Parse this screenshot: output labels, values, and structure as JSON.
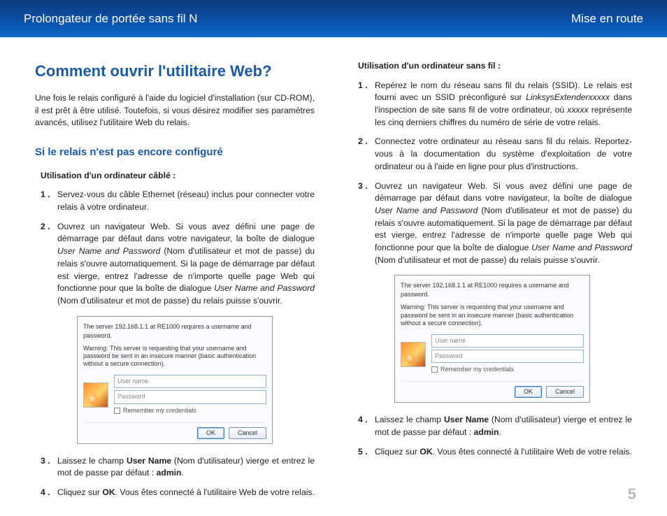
{
  "header": {
    "left": "Prolongateur de portée sans fil N",
    "right": "Mise en route"
  },
  "page_number": "5",
  "left": {
    "h1": "Comment ouvrir l'utilitaire Web?",
    "lead": "Une fois le relais configuré à l'aide du logiciel d'installation (sur CD-ROM), il est prêt à être utilisé. Toutefois, si vous désirez modifier ses paramètres avancés, utilisez l'utilitaire Web du relais.",
    "h2": "Si le relais n'est pas encore configuré",
    "subhead": "Utilisation d'un ordinateur câblé :",
    "steps": {
      "n1": "1 .",
      "s1": "Servez-vous du câble Ethernet (réseau) inclus pour connecter votre relais à votre ordinateur.",
      "n2": "2 .",
      "s2a": "Ouvrez un navigateur Web. Si vous avez défini une page de démarrage par défaut dans votre navigateur, la boîte de dialogue ",
      "s2b": "User Name and Password",
      "s2c": " (Nom d'utilisateur et mot de passe) du relais s'ouvre automatiquement. Si la page de démarrage par défaut est vierge, entrez l'adresse de n'importe quelle page Web qui fonctionne pour que la boîte de dialogue ",
      "s2d": "User Name and Password",
      "s2e": " (Nom d'utilisateur et mot de passe) du relais puisse s'ouvrir.",
      "n3": "3 .",
      "s3a": "Laissez le champ ",
      "s3b": "User Name",
      "s3c": " (Nom d'utilisateur) vierge et entrez le mot de passe par défaut : ",
      "s3d": "admin",
      "s3e": ".",
      "n4": "4 .",
      "s4a": "Cliquez sur ",
      "s4b": "OK",
      "s4c": ". Vous êtes connecté à l'utilitaire Web de votre relais."
    }
  },
  "right": {
    "subhead": "Utilisation d'un ordinateur sans fil :",
    "steps": {
      "n1": "1 .",
      "s1a": "Repérez le nom du réseau sans fil du relais (SSID). Le relais est fourni avec un SSID préconfiguré sur ",
      "s1b": "LinksysExtenderxxxxx",
      "s1c": " dans l'inspection de site sans fil de votre ordinateur, où ",
      "s1d": "xxxxx",
      "s1e": " représente les cinq derniers chiffres du numéro de série de votre relais.",
      "n2": "2 .",
      "s2": "Connectez votre ordinateur au réseau sans fil du relais. Reportez-vous à la documentation du système d'exploitation de votre ordinateur ou à l'aide en ligne pour plus d'instructions.",
      "n3": "3 .",
      "s3a": "Ouvrez un navigateur Web. Si vous avez défini une page de démarrage par défaut dans votre navigateur, la boîte de dialogue ",
      "s3b": "User Name and Password",
      "s3c": " (Nom d'utilisateur et mot de passe) du relais s'ouvre automatiquement. Si la page de démarrage par défaut est vierge, entrez l'adresse de n'importe quelle page Web qui fonctionne pour que la boîte de dialogue ",
      "s3d": "User Name and Password",
      "s3e": " (Nom d'utilisateur et mot de passe) du relais puisse s'ouvrir.",
      "n4": "4 .",
      "s4a": "Laissez le champ ",
      "s4b": "User Name",
      "s4c": " (Nom d'utilisateur) vierge et entrez le mot de passe par défaut : ",
      "s4d": "admin",
      "s4e": ".",
      "n5": "5 .",
      "s5a": "Cliquez sur ",
      "s5b": "OK",
      "s5c": ". Vous êtes connecté à l'utilitaire Web de votre relais."
    }
  },
  "dialog": {
    "server": "The server 192.168.1.1 at RE1000 requires a username and password.",
    "warn": "Warning: This server is requesting that your username and password be sent in an insecure manner (basic authentication without a secure connection).",
    "user_ph": "User name",
    "pass_ph": "Password",
    "remember": "Remember my credentials",
    "ok": "OK",
    "cancel": "Cancel"
  }
}
